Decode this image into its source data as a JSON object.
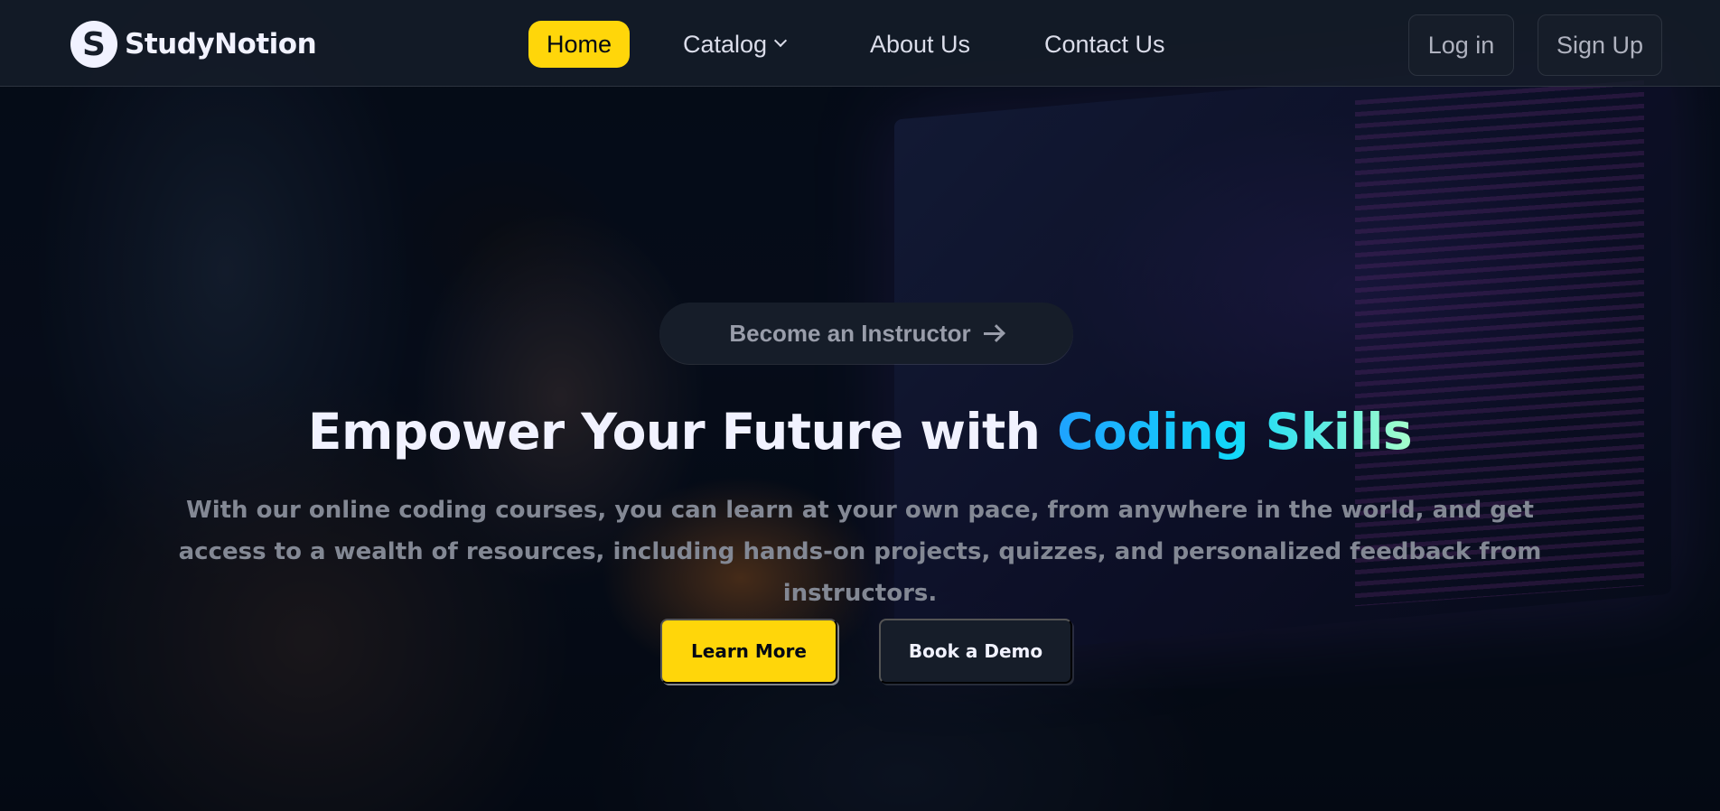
{
  "brand": {
    "logo_letter": "S",
    "name": "StudyNotion"
  },
  "nav": {
    "home": "Home",
    "catalog": "Catalog",
    "about": "About Us",
    "contact": "Contact Us"
  },
  "auth": {
    "login": "Log in",
    "signup": "Sign Up"
  },
  "hero": {
    "instructor_cta": "Become an Instructor",
    "headline_prefix": "Empower Your Future with ",
    "headline_highlight": "Coding Skills",
    "subtitle": "With our online coding courses, you can learn at your own pace, from anywhere in the world, and get access to a wealth of resources, including hands-on projects, quizzes, and personalized feedback from instructors.",
    "learn_more": "Learn More",
    "book_demo": "Book a Demo"
  },
  "colors": {
    "accent_yellow": "#ffd60a",
    "nav_bg": "#161d29",
    "gradient_start": "#1fa2ff",
    "gradient_mid": "#12d8fa",
    "gradient_end": "#a6ffcb"
  },
  "icons": {
    "catalog_dropdown": "chevron-down-icon",
    "instructor_arrow": "arrow-right-icon"
  }
}
